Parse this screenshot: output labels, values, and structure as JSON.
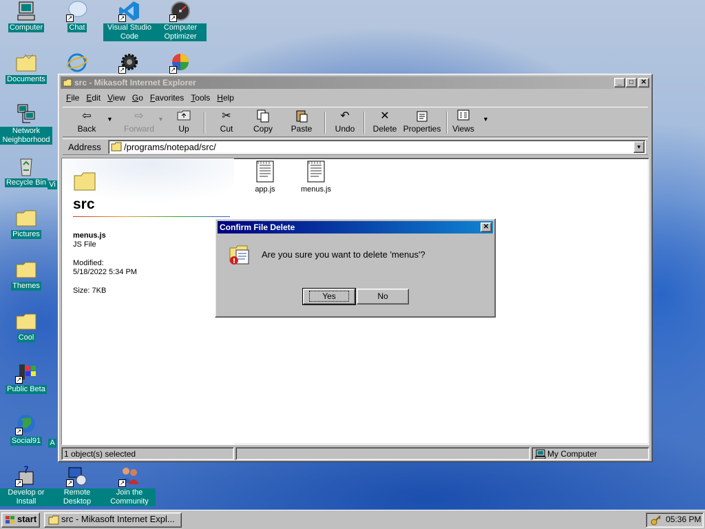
{
  "desktop": {
    "icons": [
      {
        "label": "Computer"
      },
      {
        "label": "Chat"
      },
      {
        "label": "Visual Studio Code"
      },
      {
        "label": "Computer Optimizer"
      },
      {
        "label": "Documents"
      },
      {
        "label": ""
      },
      {
        "label": ""
      },
      {
        "label": ""
      },
      {
        "label": "Network Neighborhood"
      },
      {
        "label": "Recycle Bin"
      },
      {
        "label": "Pictures"
      },
      {
        "label": "Themes"
      },
      {
        "label": "Cool"
      },
      {
        "label": "Public Beta"
      },
      {
        "label": "Social91"
      },
      {
        "label": "Develop or Install"
      },
      {
        "label": "Remote Desktop"
      },
      {
        "label": "Join the Community"
      },
      {
        "label": "Vi"
      },
      {
        "label": "A"
      }
    ]
  },
  "window": {
    "title": "src - Mikasoft Internet Explorer",
    "menu": {
      "file": {
        "key": "F",
        "rest": "ile"
      },
      "edit": {
        "key": "E",
        "rest": "dit"
      },
      "view": {
        "key": "V",
        "rest": "iew"
      },
      "go": {
        "key": "G",
        "rest": "o"
      },
      "favorites": {
        "key": "F",
        "rest": "avorites"
      },
      "tools": {
        "key": "T",
        "rest": "ools"
      },
      "help": {
        "key": "H",
        "rest": "elp"
      }
    },
    "toolbar": {
      "back": "Back",
      "forward": "Forward",
      "up": "Up",
      "cut": "Cut",
      "copy": "Copy",
      "paste": "Paste",
      "undo": "Undo",
      "delete": "Delete",
      "properties": "Properties",
      "views": "Views"
    },
    "address": {
      "label": "Address",
      "value": "/programs/notepad/src/"
    },
    "sidepane": {
      "folder_name": "src",
      "selected_name": "menus.js",
      "selected_type": "JS File",
      "modified_label": "Modified:",
      "modified_value": "5/18/2022 5:34 PM",
      "size": "Size: 7KB"
    },
    "files": [
      {
        "name": "app.js"
      },
      {
        "name": "menus.js"
      }
    ],
    "status": {
      "selection": "1 object(s) selected",
      "zone": "My Computer"
    }
  },
  "dialog": {
    "title": "Confirm File Delete",
    "message": "Are you sure you want to delete 'menus'?",
    "yes": "Yes",
    "no": "No"
  },
  "taskbar": {
    "start": "start",
    "task": "src - Mikasoft Internet Expl...",
    "clock": "05:36 PM"
  },
  "colors": {
    "desktop_label_bg": "#008080",
    "active_title": "#000080",
    "inactive_title": "#808080"
  }
}
